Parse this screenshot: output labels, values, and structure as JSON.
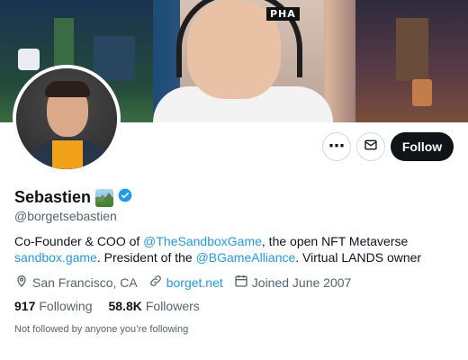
{
  "banner": {
    "logo_text": "PHA"
  },
  "actions": {
    "more_label": "⋯",
    "message_label": "",
    "follow_label": "Follow"
  },
  "profile": {
    "name": "Sebastien",
    "handle": "@borgetsebastien",
    "bio": {
      "part1": "Co-Founder & COO of ",
      "mention1": "@TheSandboxGame",
      "part2": ", the open NFT Metaverse",
      "link1": "sandbox.game",
      "part3": ". President of the ",
      "mention2": "@BGameAlliance",
      "part4": ". Virtual LANDS owner"
    },
    "location": "San Francisco, CA",
    "website": "borget.net",
    "joined": "Joined June 2007",
    "following_count": "917",
    "following_label": "Following",
    "followers_count": "58.8K",
    "followers_label": "Followers",
    "followed_by_text": "Not followed by anyone you’re following"
  },
  "colors": {
    "accent": "#1d9bf0",
    "text": "#0f1419",
    "secondary": "#536471",
    "button_dark": "#0f1419",
    "verified": "#1d9bf0"
  },
  "icons": [
    "more-icon",
    "mail-icon",
    "verified-badge-icon",
    "location-icon",
    "link-icon",
    "calendar-icon"
  ]
}
